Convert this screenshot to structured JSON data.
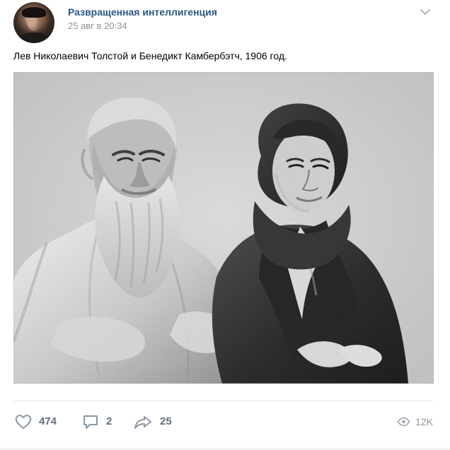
{
  "post": {
    "author": "Развращенная интеллигенция",
    "date": "25 авг в 20:34",
    "text": "Лев Николаевич Толстой и Бенедикт Камбербэтч, 1906 год."
  },
  "actions": {
    "likes": "474",
    "comments": "2",
    "shares": "25",
    "views": "12K"
  },
  "icons": {
    "menu": "chevron-down-icon",
    "like": "heart-icon",
    "comment": "comment-icon",
    "share": "share-icon",
    "views": "eye-icon"
  },
  "colors": {
    "author_link": "#2a5885",
    "muted_text": "#939393",
    "action_text": "#626d7a"
  }
}
